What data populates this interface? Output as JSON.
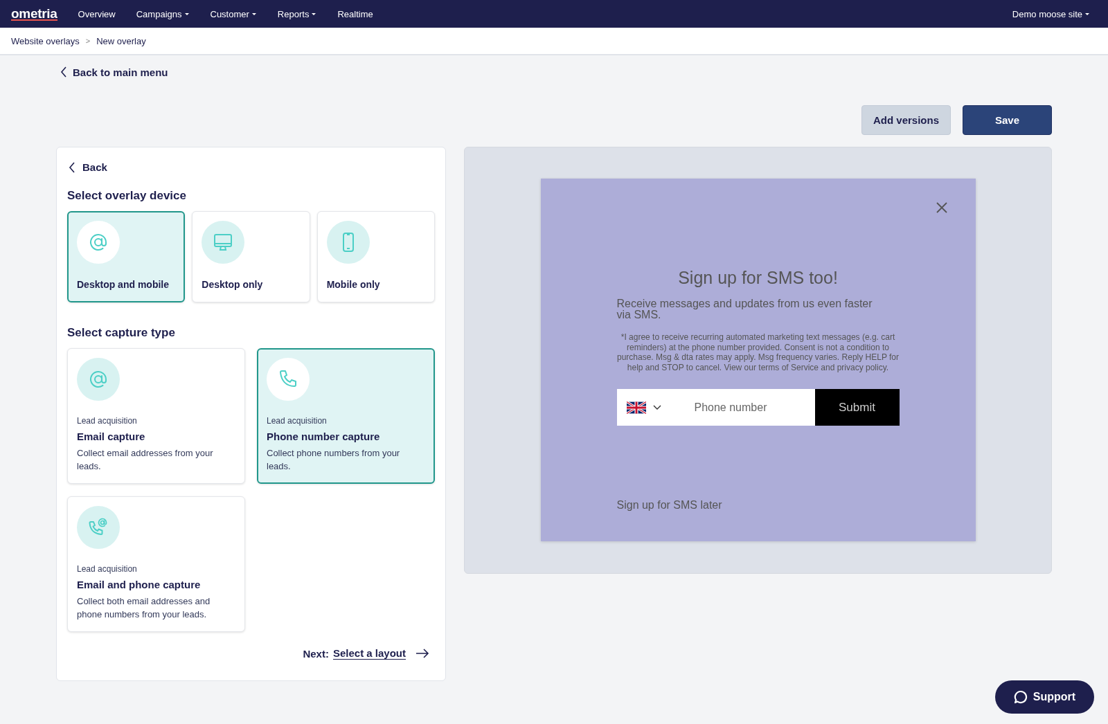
{
  "navbar": {
    "logo": "ometria",
    "menu": [
      {
        "label": "Overview",
        "dropdown": false
      },
      {
        "label": "Campaigns",
        "dropdown": true
      },
      {
        "label": "Customer",
        "dropdown": true
      },
      {
        "label": "Reports",
        "dropdown": true
      },
      {
        "label": "Realtime",
        "dropdown": false
      }
    ],
    "site": {
      "label": "Demo moose site",
      "dropdown": true
    }
  },
  "breadcrumb": [
    {
      "label": "Website overlays"
    },
    {
      "label": ">"
    },
    {
      "label": "New overlay"
    }
  ],
  "back_to_main": "Back to main menu",
  "actions": [
    {
      "label": "Add versions",
      "kind": "secondary"
    },
    {
      "label": "Save",
      "kind": "primary"
    }
  ],
  "panel": {
    "back": "Back",
    "device_heading": "Select overlay device",
    "devices": [
      {
        "label": "Desktop and mobile",
        "kind": "at",
        "selected": true
      },
      {
        "label": "Desktop only",
        "kind": "monitor",
        "selected": false
      },
      {
        "label": "Mobile only",
        "kind": "mobile",
        "selected": false
      }
    ],
    "capture_heading": "Select capture type",
    "captures": [
      {
        "category": "Lead acquisition",
        "title": "Email capture",
        "description": "Collect email addresses from your leads.",
        "kind": "at",
        "selected": false
      },
      {
        "category": "Lead acquisition",
        "title": "Phone number capture",
        "description": "Collect phone numbers from your leads.",
        "kind": "phone",
        "selected": true
      },
      {
        "category": "Lead acquisition",
        "title": "Email and phone capture",
        "description": "Collect both email addresses and phone numbers from your leads.",
        "kind": "phone-at",
        "selected": false
      }
    ],
    "next_label": "Next:",
    "next_link": "Select a layout"
  },
  "preview": {
    "title": "Sign up for SMS too!",
    "subtitle": "Receive messages and updates from us even faster via SMS.",
    "consent": "*I agree to receive recurring automated marketing text messages (e.g. cart reminders) at the phone number provided. Consent is not a condition to purchase. Msg & dta rates may apply. Msg frequency varies. Reply HELP for help and STOP to cancel. View our terms of Service and privacy policy.",
    "phone_placeholder": "Phone number",
    "submit": "Submit",
    "later": "Sign up for SMS later"
  },
  "support": "Support"
}
